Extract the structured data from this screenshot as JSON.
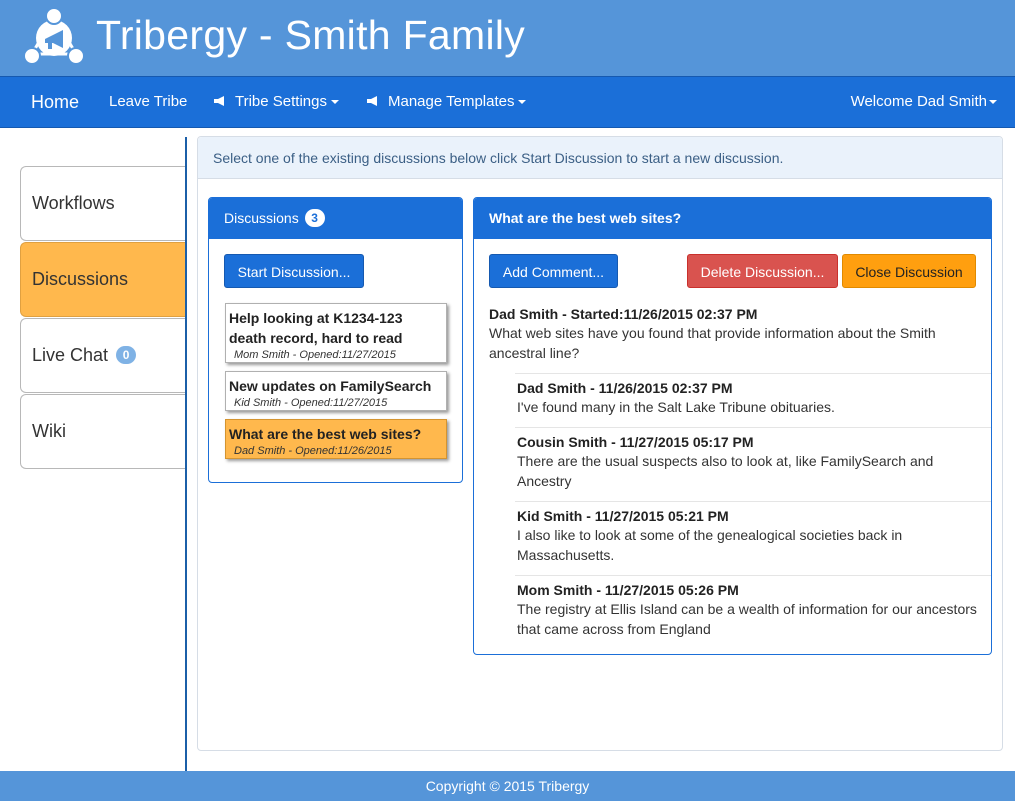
{
  "header": {
    "app_title": "Tribergy - Smith Family",
    "logo_icon": "tribe-logo-icon",
    "colors": {
      "header_bg": "#5595d9",
      "navbar_bg": "#1b6fd8"
    }
  },
  "navbar": {
    "home": "Home",
    "leave_tribe": "Leave Tribe",
    "tribe_settings": "Tribe Settings",
    "manage_templates": "Manage Templates",
    "welcome": "Welcome Dad Smith"
  },
  "sidebar": {
    "items": [
      {
        "label": "Workflows"
      },
      {
        "label": "Discussions",
        "active": true
      },
      {
        "label": "Live Chat",
        "badge": "0"
      },
      {
        "label": "Wiki"
      }
    ]
  },
  "main": {
    "info": "Select one of the existing discussions below click Start Discussion to start a new discussion."
  },
  "discussions": {
    "heading": "Discussions",
    "count": "3",
    "start_button": "Start Discussion...",
    "items": [
      {
        "title": "Help looking at K1234-123 death record, hard to read",
        "meta": "Mom Smith - Opened:11/27/2015"
      },
      {
        "title": "New updates on FamilySearch",
        "meta": "Kid Smith - Opened:11/27/2015"
      },
      {
        "title": "What are the best web sites?",
        "meta": "Dad Smith - Opened:11/26/2015",
        "selected": true
      }
    ]
  },
  "thread": {
    "title": "What are the best web sites?",
    "add_comment": "Add Comment...",
    "delete": "Delete Discussion...",
    "close": "Close Discussion",
    "starter": {
      "author": "Dad Smith - Started:11/26/2015 02:37 PM",
      "text": "What web sites have you found that provide information about the Smith ancestral line?"
    },
    "replies": [
      {
        "author": "Dad Smith - 11/26/2015 02:37 PM",
        "text": "I've found many in the Salt Lake Tribune obituaries."
      },
      {
        "author": "Cousin Smith - 11/27/2015 05:17 PM",
        "text": "There are the usual suspects also to look at, like FamilySearch and Ancestry"
      },
      {
        "author": "Kid Smith - 11/27/2015 05:21 PM",
        "text": "I also like to look at some of the genealogical societies back in Massachusetts."
      },
      {
        "author": "Mom Smith - 11/27/2015 05:26 PM",
        "text": "The registry at Ellis Island can be a wealth of information for our ancestors that came across from England"
      }
    ]
  },
  "footer": {
    "copyright": "Copyright © 2015 Tribergy"
  }
}
